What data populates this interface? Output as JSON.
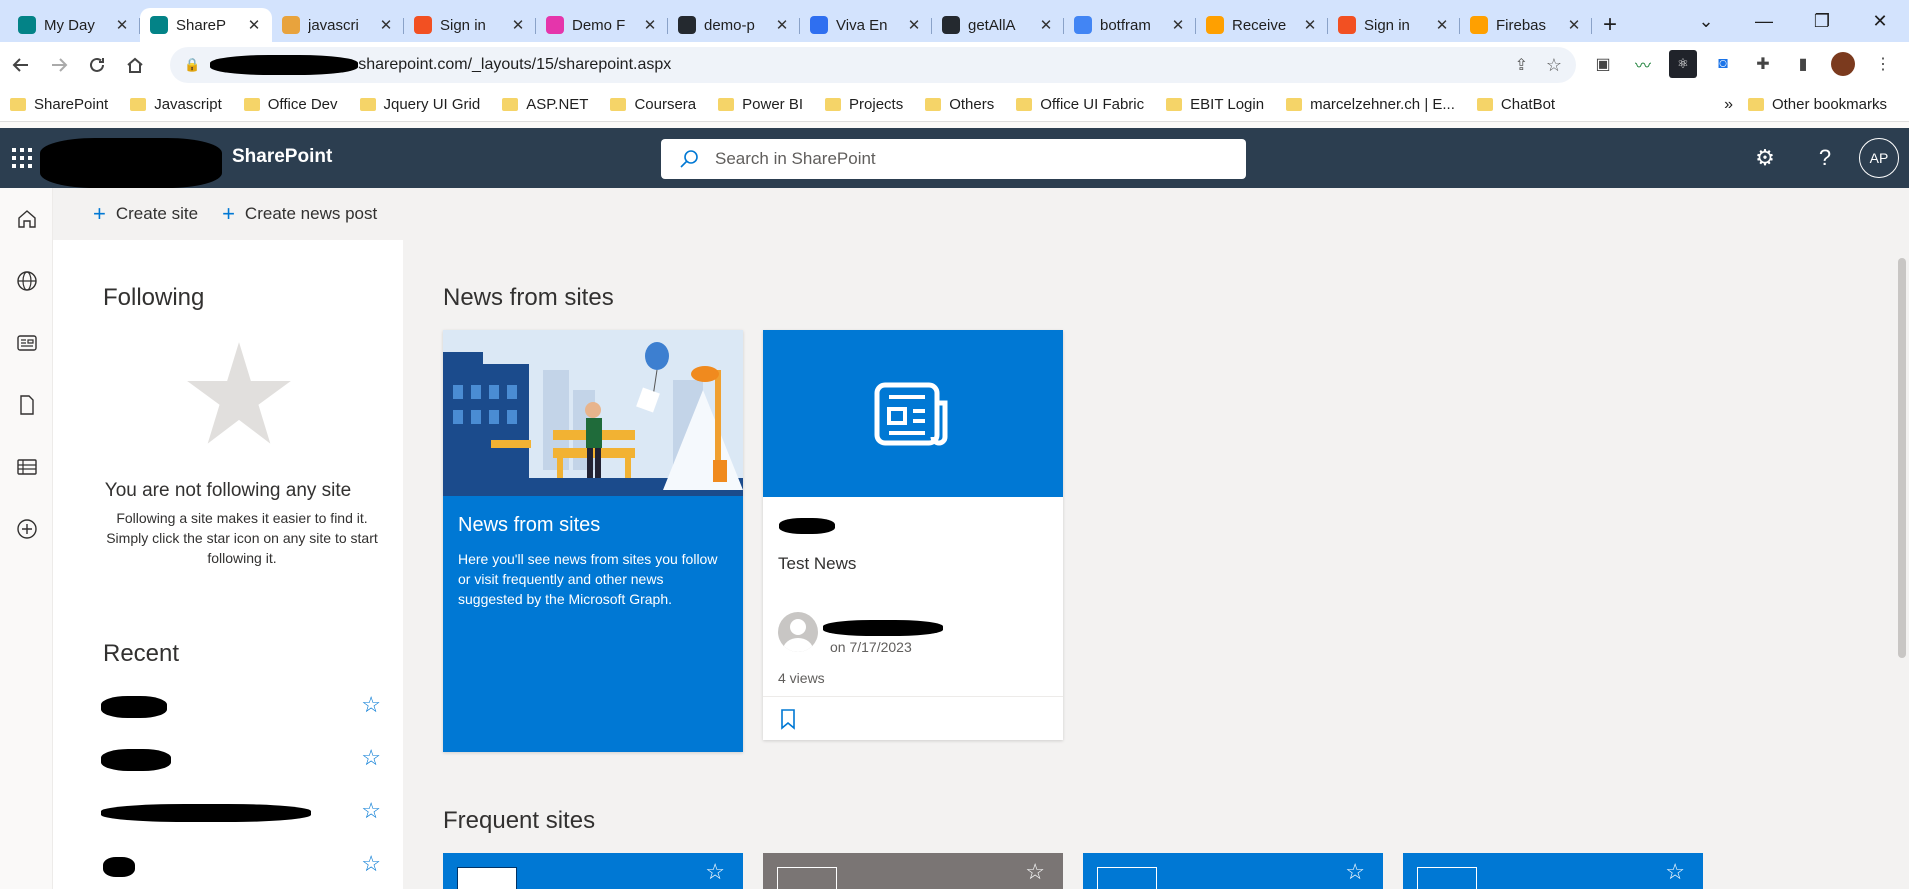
{
  "browser": {
    "tabs": [
      {
        "label": "My Day",
        "icon": "sharepoint-icon",
        "color": "#038387",
        "active": false
      },
      {
        "label": "ShareP",
        "icon": "sharepoint-icon",
        "color": "#038387",
        "active": true
      },
      {
        "label": "javascri",
        "icon": "javascript-icon",
        "color": "#e8a33d",
        "active": false
      },
      {
        "label": "Sign in",
        "icon": "microsoft-icon",
        "color": "#f25022",
        "active": false
      },
      {
        "label": "Demo F",
        "icon": "graphql-icon",
        "color": "#e535ab",
        "active": false
      },
      {
        "label": "demo-p",
        "icon": "github-icon",
        "color": "#24292f",
        "active": false
      },
      {
        "label": "Viva En",
        "icon": "viva-icon",
        "color": "#2f6ff0",
        "active": false
      },
      {
        "label": "getAllA",
        "icon": "github-icon",
        "color": "#24292f",
        "active": false
      },
      {
        "label": "botfram",
        "icon": "google-icon",
        "color": "#4285f4",
        "active": false
      },
      {
        "label": "Receive",
        "icon": "firebase-icon",
        "color": "#ffa000",
        "active": false
      },
      {
        "label": "Sign in",
        "icon": "microsoft-icon",
        "color": "#f25022",
        "active": false
      },
      {
        "label": "Firebas",
        "icon": "firebase-icon",
        "color": "#ffa000",
        "active": false
      }
    ],
    "url": "sharepoint.com/_layouts/15/sharepoint.aspx",
    "bookmarks": [
      "SharePoint",
      "Javascript",
      "Office Dev",
      "Jquery UI Grid",
      "ASP.NET",
      "Coursera",
      "Power BI",
      "Projects",
      "Others",
      "Office UI Fabric",
      "EBIT Login",
      "marcelzehner.ch | E...",
      "ChatBot"
    ],
    "more_bookmarks": "»",
    "other_bookmarks": "Other bookmarks"
  },
  "suitebar": {
    "brand": "SharePoint",
    "search_placeholder": "Search in SharePoint",
    "avatar_initials": "AP",
    "help": "?"
  },
  "commands": {
    "create_site": "Create site",
    "create_news": "Create news post"
  },
  "following": {
    "title": "Following",
    "empty_title": "You are not following any site",
    "empty_text": "Following a site makes it easier to find it. Simply click the star icon on any site to start following it."
  },
  "recent": {
    "title": "Recent"
  },
  "news": {
    "title": "News from sites",
    "intro_card": {
      "title": "News from sites",
      "text": "Here you'll see news from sites you follow or visit frequently and other news suggested by the Microsoft Graph."
    },
    "post": {
      "title": "Test News",
      "date": "on 7/17/2023",
      "views": "4 views"
    }
  },
  "frequent": {
    "title": "Frequent sites"
  },
  "colors": {
    "suitebar": "#2c3e50",
    "accent": "#0078d4",
    "chrome_tabs": "#d3e3fd"
  }
}
